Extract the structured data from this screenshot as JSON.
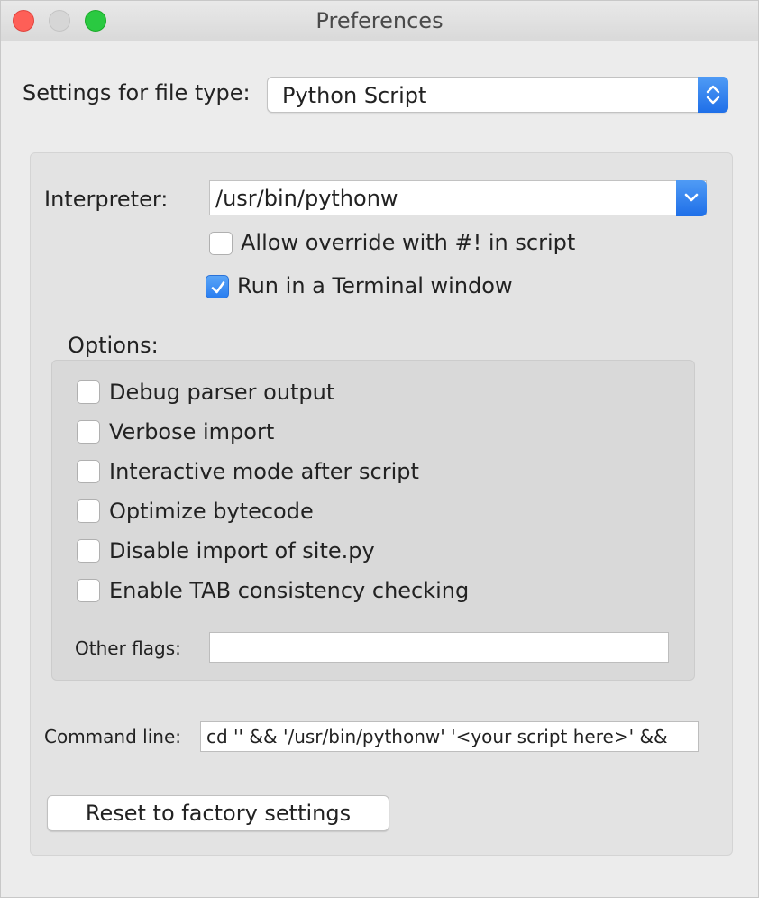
{
  "window": {
    "title": "Preferences"
  },
  "file_type": {
    "label": "Settings for file type:",
    "selected": "Python Script"
  },
  "interpreter": {
    "label": "Interpreter:",
    "value": "/usr/bin/pythonw"
  },
  "checkboxes": {
    "allow_override": {
      "label": "Allow override with #! in script",
      "checked": false
    },
    "run_in_terminal": {
      "label": "Run in a Terminal window",
      "checked": true
    }
  },
  "options": {
    "label": "Options:",
    "items": [
      {
        "label": "Debug parser output",
        "checked": false
      },
      {
        "label": "Verbose import",
        "checked": false
      },
      {
        "label": "Interactive mode after script",
        "checked": false
      },
      {
        "label": "Optimize bytecode",
        "checked": false
      },
      {
        "label": "Disable import of site.py",
        "checked": false
      },
      {
        "label": "Enable TAB consistency checking",
        "checked": false
      }
    ],
    "other_flags_label": "Other flags:",
    "other_flags_value": ""
  },
  "command_line": {
    "label": "Command line:",
    "value": "cd '' && '/usr/bin/pythonw'  '<your script here>'  &&"
  },
  "buttons": {
    "reset_label": "Reset to factory settings"
  },
  "colors": {
    "accent": "#2a7ef0",
    "close": "#fe5f57",
    "zoom": "#2ac941"
  }
}
